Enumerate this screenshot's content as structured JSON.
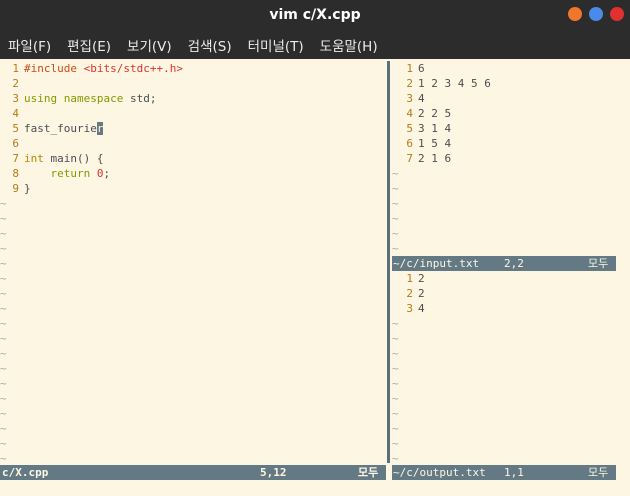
{
  "window": {
    "title": "vim c/X.cpp",
    "button_colors": {
      "minimize": "#f0762c",
      "maximize": "#4a8ae8",
      "close": "#e0312e"
    }
  },
  "menu": [
    "파일(F)",
    "편집(E)",
    "보기(V)",
    "검색(S)",
    "터미널(T)",
    "도움말(H)"
  ],
  "left_pane": {
    "lines": [
      {
        "n": "1",
        "text": "#include <bits/stdc++.h>"
      },
      {
        "n": "2",
        "text": ""
      },
      {
        "n": "3",
        "text": "using namespace std;"
      },
      {
        "n": "4",
        "text": ""
      },
      {
        "n": "5",
        "text": "fast_fourier"
      },
      {
        "n": "6",
        "text": ""
      },
      {
        "n": "7",
        "text": "int main() {"
      },
      {
        "n": "8",
        "text": "    return 0;"
      },
      {
        "n": "9",
        "text": "}"
      }
    ],
    "tilde_count": 18,
    "status": {
      "file": "c/X.cpp",
      "position": "5,12",
      "scroll": "모두"
    }
  },
  "top_right_pane": {
    "lines": [
      {
        "n": "1",
        "text": "6"
      },
      {
        "n": "2",
        "text": "1 2 3 4 5 6"
      },
      {
        "n": "3",
        "text": "4"
      },
      {
        "n": "4",
        "text": "2 2 5"
      },
      {
        "n": "5",
        "text": "3 1 4"
      },
      {
        "n": "6",
        "text": "1 5 4"
      },
      {
        "n": "7",
        "text": "2 1 6"
      }
    ],
    "tilde_count": 6,
    "status": {
      "file": "~/c/input.txt",
      "position": "2,2",
      "scroll": "모두"
    }
  },
  "bottom_right_pane": {
    "lines": [
      {
        "n": "1",
        "text": "2"
      },
      {
        "n": "2",
        "text": "2"
      },
      {
        "n": "3",
        "text": "4"
      }
    ],
    "tilde_count": 10,
    "status": {
      "file": "~/c/output.txt",
      "position": "1,1",
      "scroll": "모두"
    }
  },
  "colors": {
    "background": "#fdf6e3",
    "line_number": "#b37b1b",
    "statusline": "#637a85",
    "titlebar": "#2c2c2c"
  }
}
